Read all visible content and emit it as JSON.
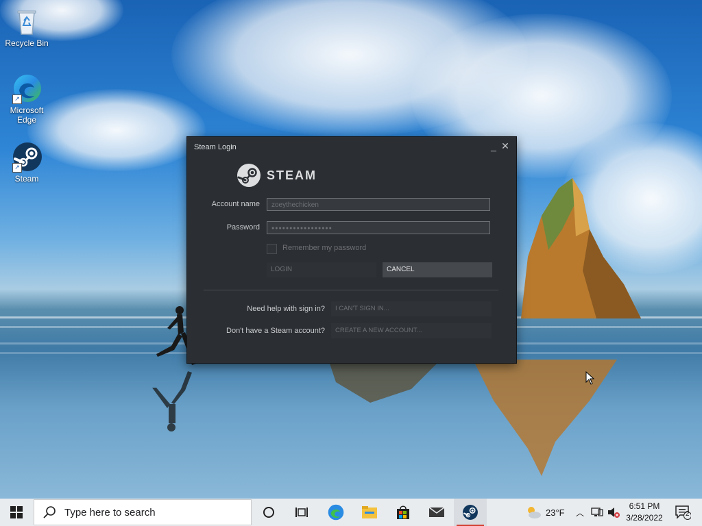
{
  "desktop": {
    "icons": [
      {
        "label": "Recycle Bin",
        "icon": "recycle-bin-icon"
      },
      {
        "label": "Microsoft Edge",
        "icon": "edge-icon"
      },
      {
        "label": "Steam",
        "icon": "steam-icon"
      }
    ]
  },
  "steam_login": {
    "title": "Steam Login",
    "logo_text": "STEAM",
    "account_label": "Account name",
    "account_value": "zoeythechicken",
    "password_label": "Password",
    "password_value": "●●●●●●●●●●●●●●●●●",
    "remember_label": "Remember my password",
    "remember_checked": false,
    "login_button": "LOGIN",
    "cancel_button": "CANCEL",
    "help_label": "Need help with sign in?",
    "help_button": "I CAN'T SIGN IN...",
    "no_account_label": "Don't have a Steam account?",
    "create_button": "CREATE A NEW ACCOUNT..."
  },
  "taskbar": {
    "search_placeholder": "Type here to search",
    "pinned": [
      "cortana-icon",
      "task-view-icon",
      "edge-icon",
      "file-explorer-icon",
      "store-icon",
      "mail-icon",
      "steam-icon"
    ],
    "active_app": "steam-icon",
    "weather": "23°F",
    "time": "6:51 PM",
    "date": "3/28/2022",
    "notification_count": "2"
  }
}
